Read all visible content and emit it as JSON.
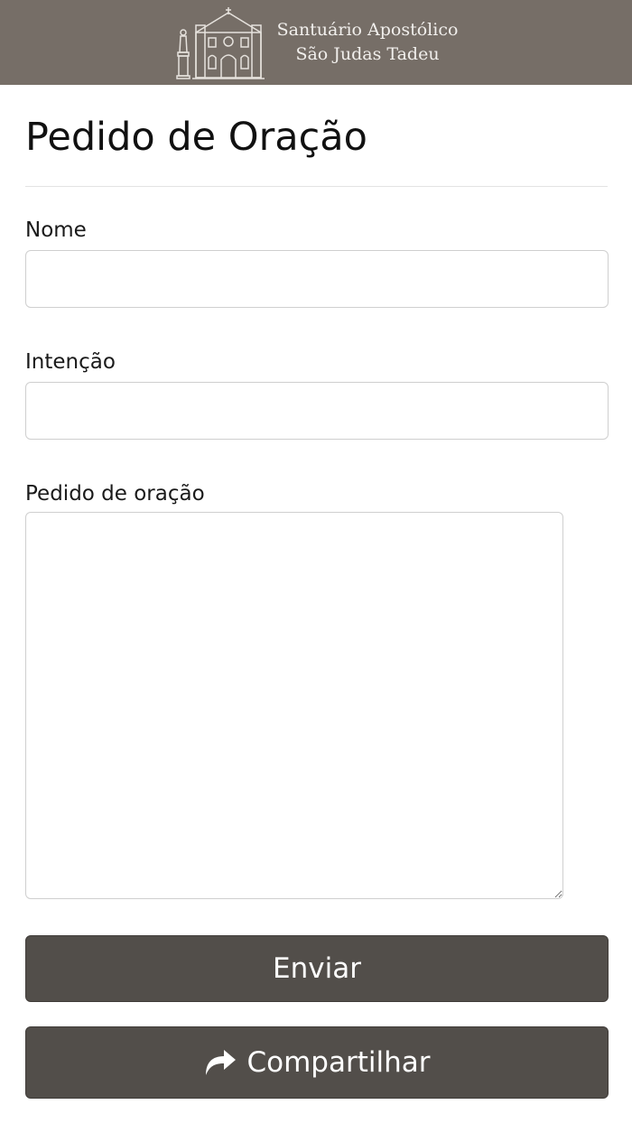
{
  "header": {
    "logo_line1": "Santuário Apostólico",
    "logo_line2": "São Judas Tadeu",
    "background_color": "#766e67"
  },
  "page": {
    "title": "Pedido de Oração"
  },
  "form": {
    "name_label": "Nome",
    "name_value": "",
    "intention_label": "Intenção",
    "intention_value": "",
    "request_label": "Pedido de oração",
    "request_value": ""
  },
  "buttons": {
    "send_label": "Enviar",
    "share_label": "Compartilhar",
    "share_icon": "share-arrow-icon",
    "button_color": "#524e4a"
  }
}
